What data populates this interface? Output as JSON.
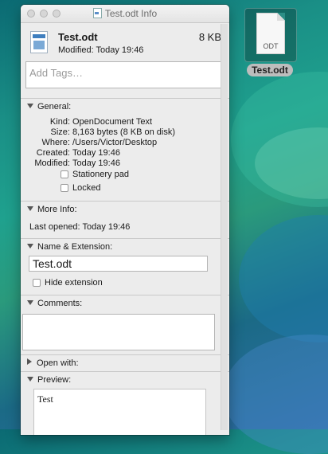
{
  "window": {
    "title": "Test.odt Info",
    "file_name": "Test.odt",
    "file_size": "8 KB",
    "modified_line": "Modified: Today 19:46",
    "tags_placeholder": "Add Tags…"
  },
  "general": {
    "header": "General:",
    "rows": [
      {
        "key": "Kind:",
        "value": "OpenDocument Text"
      },
      {
        "key": "Size:",
        "value": "8,163 bytes (8 KB on disk)"
      },
      {
        "key": "Where:",
        "value": "/Users/Victor/Desktop"
      },
      {
        "key": "Created:",
        "value": "Today 19:46"
      },
      {
        "key": "Modified:",
        "value": "Today 19:46"
      }
    ],
    "stationery_label": "Stationery pad",
    "locked_label": "Locked"
  },
  "more_info": {
    "header": "More Info:",
    "last_opened": "Last opened: Today 19:46"
  },
  "name_ext": {
    "header": "Name & Extension:",
    "name_value": "Test.odt",
    "hide_ext_label": "Hide extension"
  },
  "comments": {
    "header": "Comments:"
  },
  "open_with": {
    "header": "Open with:"
  },
  "preview": {
    "header": "Preview:",
    "text": "Test"
  },
  "desktop_icon": {
    "ext": "ODT",
    "label": "Test.odt"
  }
}
